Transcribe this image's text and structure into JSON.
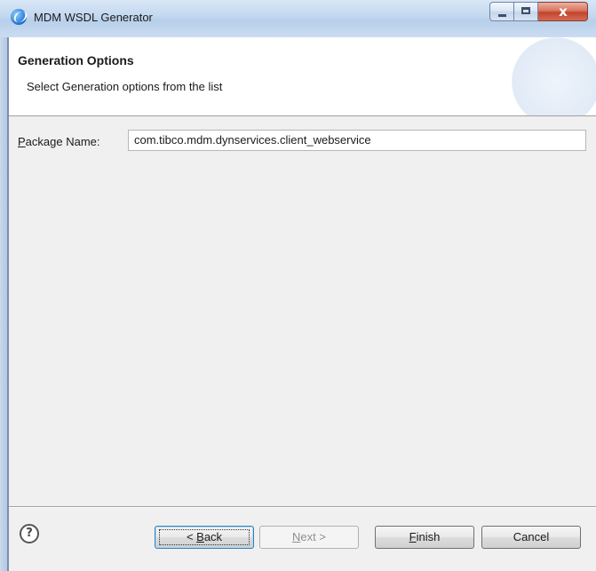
{
  "window": {
    "title": "MDM WSDL Generator",
    "controls": {
      "minimize": "minimize",
      "maximize": "maximize",
      "close": "x"
    }
  },
  "header": {
    "title": "Generation Options",
    "subtitle": "Select Generation options from the list"
  },
  "form": {
    "package_label_mnemonic": "P",
    "package_label_rest": "ackage Name:",
    "package_value": "com.tibco.mdm.dynservices.client_webservice"
  },
  "buttons": {
    "back_prefix": "< ",
    "back_mnemonic": "B",
    "back_rest": "ack",
    "next_mnemonic": "N",
    "next_rest": "ext >",
    "finish_mnemonic": "F",
    "finish_rest": "inish",
    "cancel": "Cancel"
  },
  "help": {
    "glyph": "?"
  },
  "colors": {
    "titlebar": "#c2d7ef",
    "dialog_bg": "#f0f0f0",
    "close_button": "#c2452b",
    "focus_border": "#3c7fb1"
  }
}
